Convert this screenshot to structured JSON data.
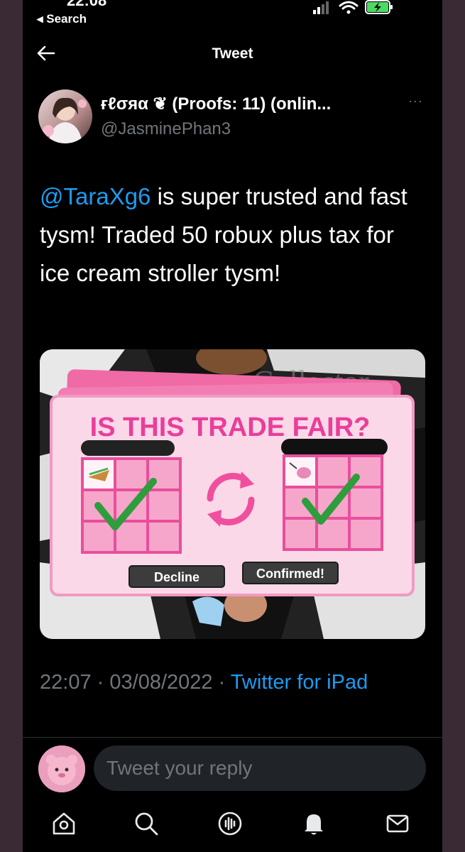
{
  "status_bar": {
    "time": "22:08",
    "back_label": "◂ Search",
    "icons": [
      "signal-icon",
      "wifi-icon",
      "battery-charging-icon"
    ]
  },
  "nav": {
    "title": "Tweet",
    "back_icon": "back-arrow-icon"
  },
  "tweet": {
    "display_name": "ғℓσяα ❦ (Proofs: 11) (onlin...",
    "handle": "@JasminePhan3",
    "more_icon": "more-dots-icon",
    "mention": "@TaraXg6",
    "body": " is super trusted and fast tysm! Traded 50 robux plus tax for ice cream stroller tysm!",
    "media": {
      "headline": "IS THIS TRADE FAIR?",
      "decline_label": "Decline",
      "confirm_label": "Confirmed!",
      "background_text": "Collector"
    },
    "time": "22:07",
    "date": "03/08/2022",
    "separator": "·",
    "source": "Twitter for iPad"
  },
  "reply": {
    "placeholder": "Tweet your reply"
  },
  "tabbar": {
    "items": [
      "home-icon",
      "search-icon",
      "spaces-icon",
      "notifications-icon",
      "messages-icon"
    ]
  },
  "colors": {
    "accent": "#1d9bf0",
    "background": "#000000",
    "muted": "#71767b",
    "trade_pink": "#e93e9b",
    "check_green": "#2e9d3c"
  }
}
